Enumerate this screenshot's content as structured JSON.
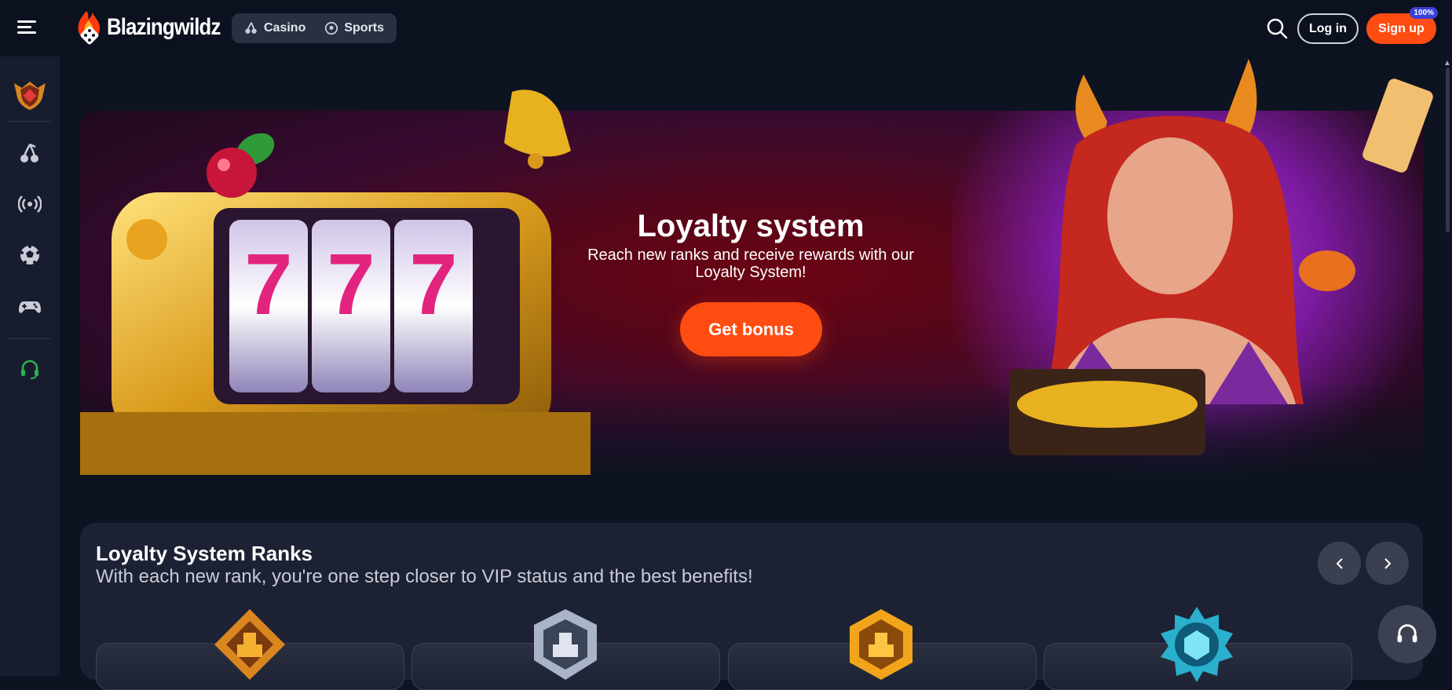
{
  "header": {
    "brand": "Blazingwildz",
    "modes": [
      {
        "label": "Casino",
        "icon": "cherry-icon"
      },
      {
        "label": "Sports",
        "icon": "football-icon"
      }
    ],
    "login_label": "Log in",
    "signup_label": "Sign up",
    "signup_badge": "100%"
  },
  "sidebar": {
    "items": [
      {
        "name": "loyalty-shield-icon"
      },
      {
        "name": "cherry-icon"
      },
      {
        "name": "live-broadcast-icon"
      },
      {
        "name": "football-icon"
      },
      {
        "name": "gamepad-icon"
      },
      {
        "name": "support-headset-icon"
      }
    ]
  },
  "banner": {
    "title": "Loyalty system",
    "subtitle": "Reach new ranks and receive rewards with our Loyalty System!",
    "cta": "Get bonus"
  },
  "ranks": {
    "title": "Loyalty System Ranks",
    "subtitle": "With each new rank, you're one step closer to VIP status and the best benefits!"
  },
  "colors": {
    "accent": "#ff4d12",
    "background": "#0e1321",
    "panel": "#1c2233"
  }
}
